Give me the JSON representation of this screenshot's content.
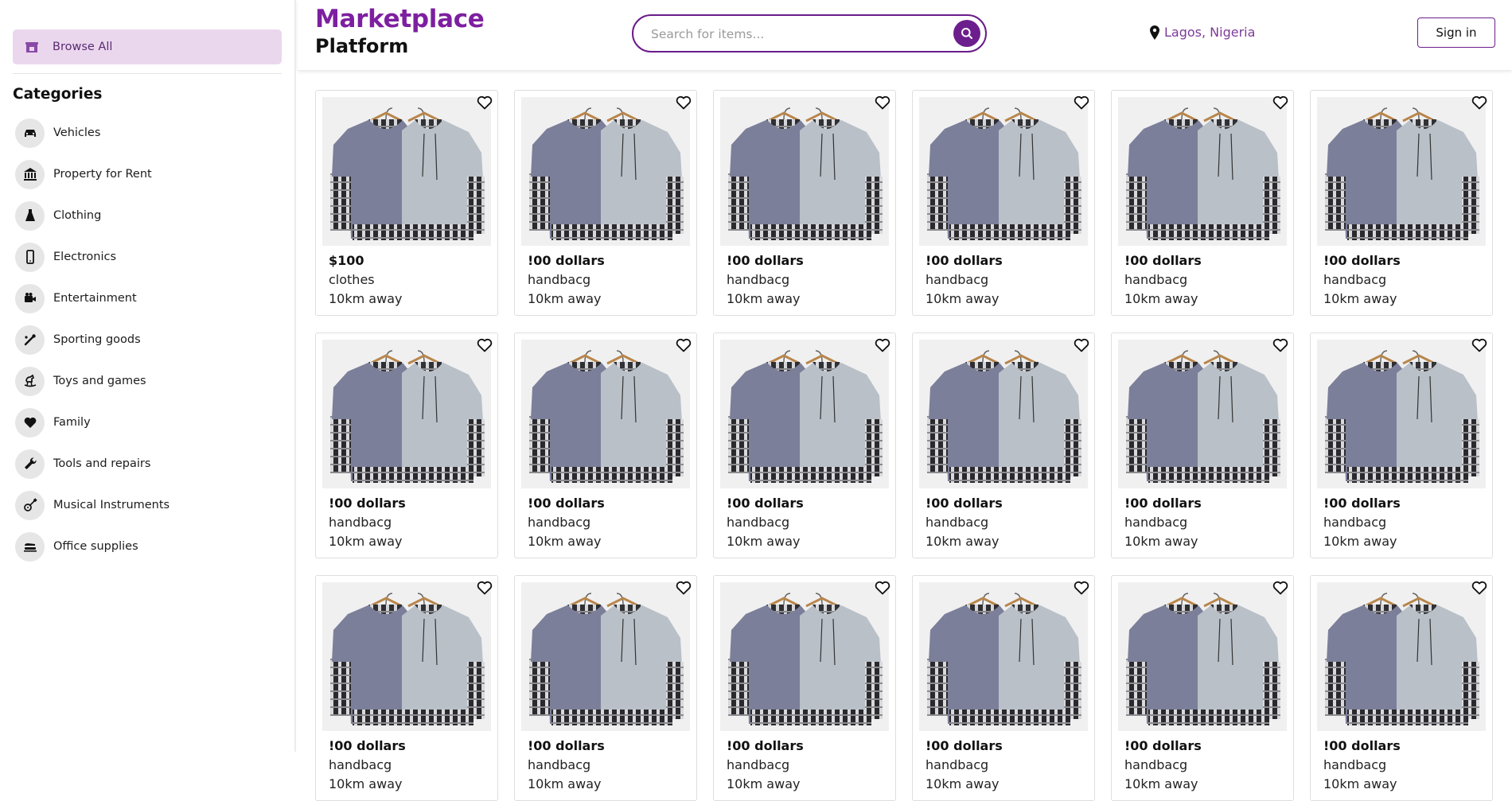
{
  "sidebar": {
    "browse_all": "Browse All",
    "categories_heading": "Categories",
    "categories": [
      {
        "label": "Vehicles",
        "icon": "car-icon"
      },
      {
        "label": "Property for Rent",
        "icon": "bank-icon"
      },
      {
        "label": "Clothing",
        "icon": "dress-icon"
      },
      {
        "label": "Electronics",
        "icon": "phone-icon"
      },
      {
        "label": "Entertainment",
        "icon": "video-camera-icon"
      },
      {
        "label": "Sporting goods",
        "icon": "sport-icon"
      },
      {
        "label": "Toys and games",
        "icon": "rocking-horse-icon"
      },
      {
        "label": "Family",
        "icon": "heart-icon"
      },
      {
        "label": "Tools and repairs",
        "icon": "wrench-icon"
      },
      {
        "label": "Musical Instruments",
        "icon": "guitar-icon"
      },
      {
        "label": "Office supplies",
        "icon": "stapler-icon"
      }
    ]
  },
  "header": {
    "brand_line1": "Marketplace",
    "brand_line2": "Platform",
    "search_placeholder": "Search for items...",
    "location": "Lagos, Nigeria",
    "sign_in": "Sign in"
  },
  "listings": [
    {
      "price": "$100",
      "title": "clothes",
      "distance": "10km away"
    },
    {
      "price": "!00 dollars",
      "title": "handbacg",
      "distance": "10km away"
    },
    {
      "price": "!00 dollars",
      "title": "handbacg",
      "distance": "10km away"
    },
    {
      "price": "!00 dollars",
      "title": "handbacg",
      "distance": "10km away"
    },
    {
      "price": "!00 dollars",
      "title": "handbacg",
      "distance": "10km away"
    },
    {
      "price": "!00 dollars",
      "title": "handbacg",
      "distance": "10km away"
    },
    {
      "price": "!00 dollars",
      "title": "handbacg",
      "distance": "10km away"
    },
    {
      "price": "!00 dollars",
      "title": "handbacg",
      "distance": "10km away"
    },
    {
      "price": "!00 dollars",
      "title": "handbacg",
      "distance": "10km away"
    },
    {
      "price": "!00 dollars",
      "title": "handbacg",
      "distance": "10km away"
    },
    {
      "price": "!00 dollars",
      "title": "handbacg",
      "distance": "10km away"
    },
    {
      "price": "!00 dollars",
      "title": "handbacg",
      "distance": "10km away"
    },
    {
      "price": "!00 dollars",
      "title": "handbacg",
      "distance": "10km away"
    },
    {
      "price": "!00 dollars",
      "title": "handbacg",
      "distance": "10km away"
    },
    {
      "price": "!00 dollars",
      "title": "handbacg",
      "distance": "10km away"
    },
    {
      "price": "!00 dollars",
      "title": "handbacg",
      "distance": "10km away"
    },
    {
      "price": "!00 dollars",
      "title": "handbacg",
      "distance": "10km away"
    },
    {
      "price": "!00 dollars",
      "title": "handbacg",
      "distance": "10km away"
    }
  ],
  "colors": {
    "brand_purple": "#7d1fa0",
    "button_purple": "#6c1f8c",
    "browse_highlight": "#ead7ee"
  }
}
